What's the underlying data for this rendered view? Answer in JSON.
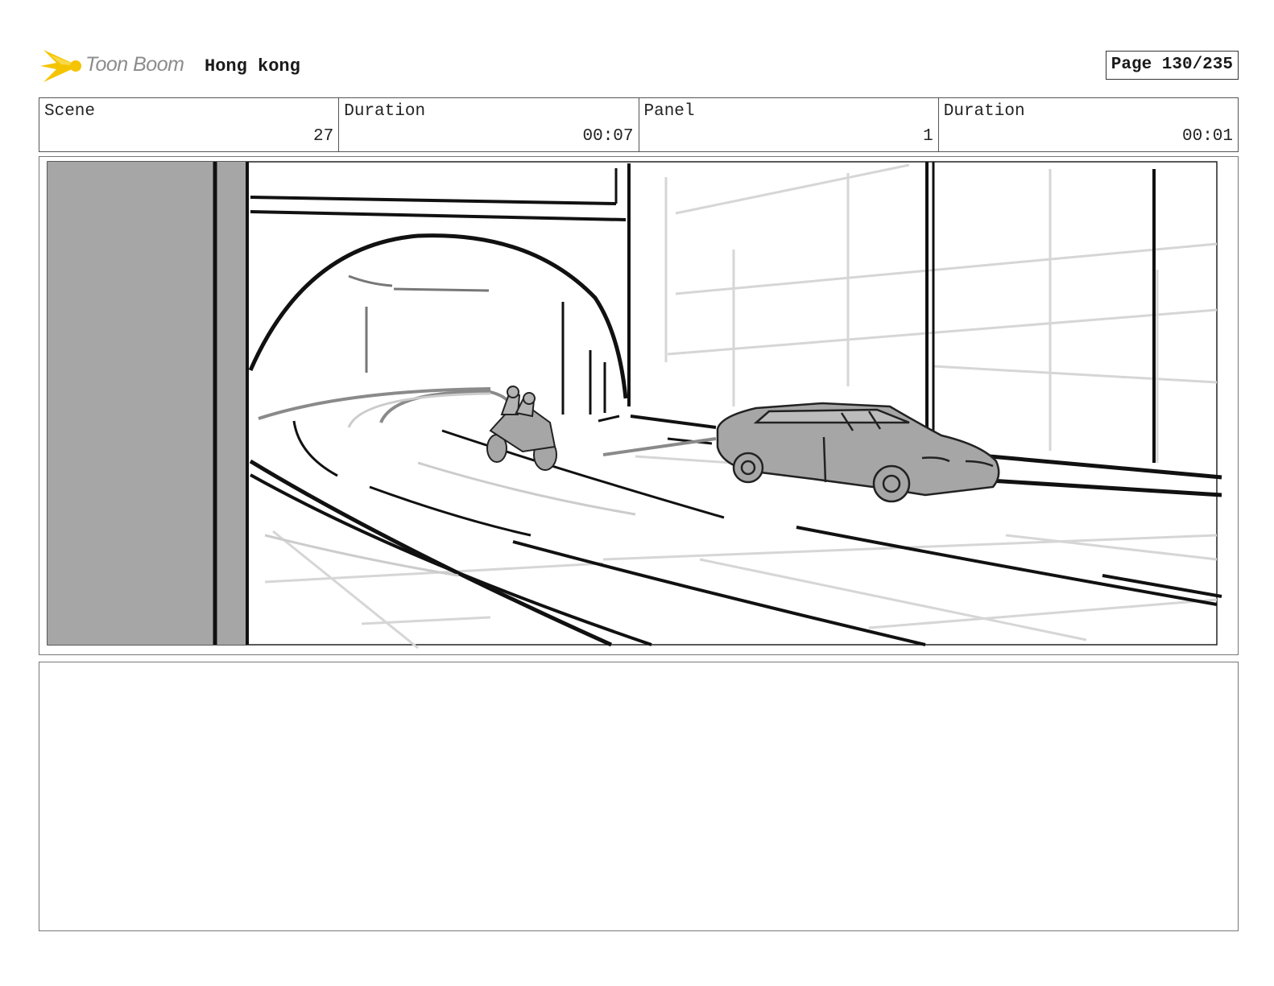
{
  "header": {
    "logo_text": "Toon Boom",
    "project_title": "Hong kong",
    "page_label": "Page 130/235"
  },
  "info": {
    "scene_label": "Scene",
    "scene_value": "27",
    "scene_duration_label": "Duration",
    "scene_duration_value": "00:07",
    "panel_label": "Panel",
    "panel_value": "1",
    "panel_duration_label": "Duration",
    "panel_duration_value": "00:01"
  },
  "colors": {
    "logo_yellow": "#f5c400",
    "sketch_gray": "#a6a6a6",
    "ink": "#111111"
  }
}
